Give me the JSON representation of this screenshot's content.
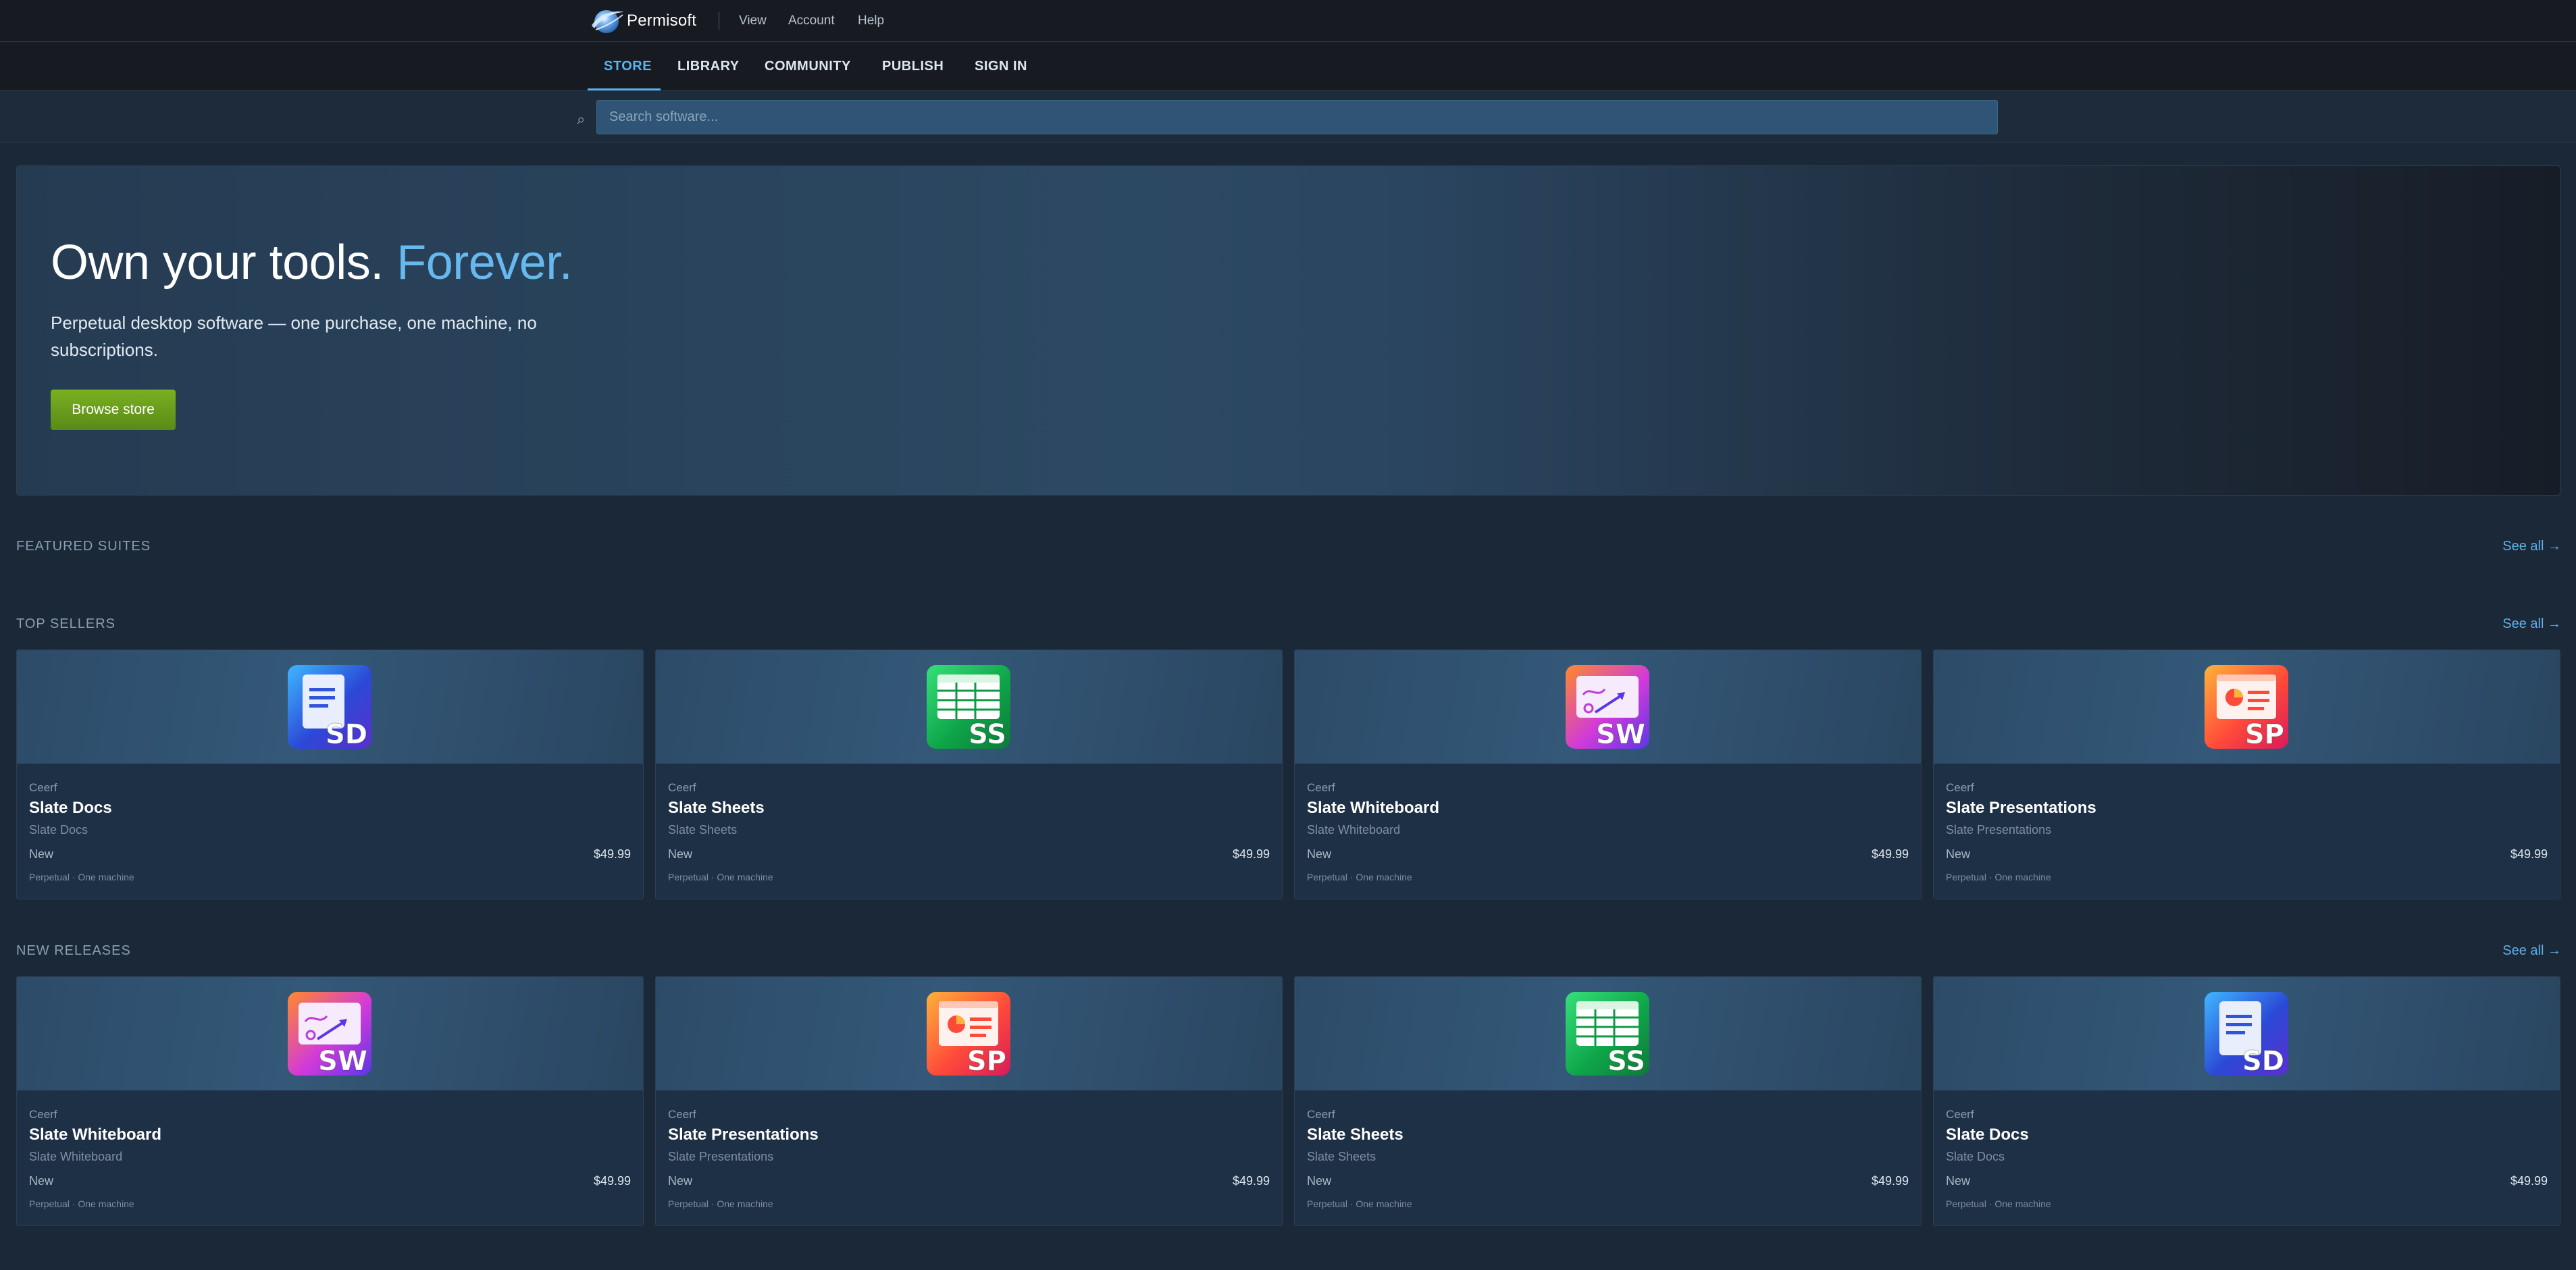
{
  "app": {
    "name": "Permisoft"
  },
  "topmenu": [
    "View",
    "Account",
    "Help"
  ],
  "nav": {
    "tabs": [
      "STORE",
      "LIBRARY",
      "COMMUNITY",
      "PUBLISH",
      "SIGN IN"
    ],
    "active": "STORE"
  },
  "search": {
    "placeholder": "Search software..."
  },
  "hero": {
    "title_main": "Own your tools.",
    "title_accent": "Forever.",
    "subtitle": "Perpetual desktop software — one purchase, one machine, no subscriptions.",
    "button": "Browse store"
  },
  "sections": {
    "featured": {
      "title": "FEATURED SUITES",
      "link": "See all →"
    },
    "top_sellers": {
      "title": "TOP SELLERS",
      "link": "See all →"
    },
    "new_releases": {
      "title": "NEW RELEASES",
      "link": "See all →"
    }
  },
  "top_sellers": [
    {
      "publisher": "Ceerf",
      "name": "Slate Docs",
      "subtitle": "Slate Docs",
      "badge": "New",
      "price": "$49.99",
      "license": "Perpetual · One machine",
      "icon": "docs",
      "icon_label": "SD"
    },
    {
      "publisher": "Ceerf",
      "name": "Slate Sheets",
      "subtitle": "Slate Sheets",
      "badge": "New",
      "price": "$49.99",
      "license": "Perpetual · One machine",
      "icon": "sheets",
      "icon_label": "SS"
    },
    {
      "publisher": "Ceerf",
      "name": "Slate Whiteboard",
      "subtitle": "Slate Whiteboard",
      "badge": "New",
      "price": "$49.99",
      "license": "Perpetual · One machine",
      "icon": "whiteboard",
      "icon_label": "SW"
    },
    {
      "publisher": "Ceerf",
      "name": "Slate Presentations",
      "subtitle": "Slate Presentations",
      "badge": "New",
      "price": "$49.99",
      "license": "Perpetual · One machine",
      "icon": "presentations",
      "icon_label": "SP"
    }
  ],
  "new_releases": [
    {
      "publisher": "Ceerf",
      "name": "Slate Whiteboard",
      "subtitle": "Slate Whiteboard",
      "badge": "New",
      "price": "$49.99",
      "license": "Perpetual · One machine",
      "icon": "whiteboard",
      "icon_label": "SW"
    },
    {
      "publisher": "Ceerf",
      "name": "Slate Presentations",
      "subtitle": "Slate Presentations",
      "badge": "New",
      "price": "$49.99",
      "license": "Perpetual · One machine",
      "icon": "presentations",
      "icon_label": "SP"
    },
    {
      "publisher": "Ceerf",
      "name": "Slate Sheets",
      "subtitle": "Slate Sheets",
      "badge": "New",
      "price": "$49.99",
      "license": "Perpetual · One machine",
      "icon": "sheets",
      "icon_label": "SS"
    },
    {
      "publisher": "Ceerf",
      "name": "Slate Docs",
      "subtitle": "Slate Docs",
      "badge": "New",
      "price": "$49.99",
      "license": "Perpetual · One machine",
      "icon": "docs",
      "icon_label": "SD"
    }
  ],
  "colors": {
    "accent": "#59b4f0",
    "button": "#6aa01c",
    "background": "#1b2838"
  }
}
